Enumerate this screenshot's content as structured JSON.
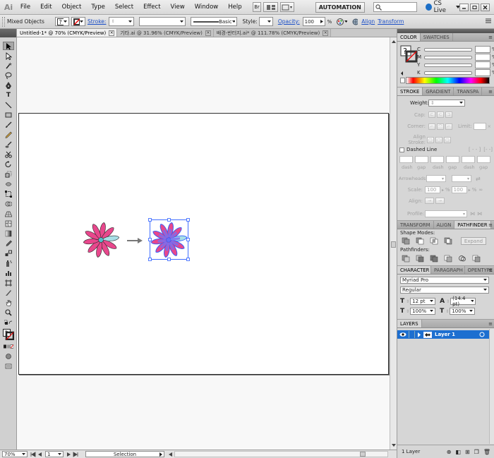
{
  "app_logo": "Ai",
  "menu": [
    "File",
    "Edit",
    "Object",
    "Type",
    "Select",
    "Effect",
    "View",
    "Window",
    "Help"
  ],
  "menubar": {
    "br_label": "Br",
    "workspace": "AUTOMATION",
    "cslive": "CS Live"
  },
  "control_bar": {
    "selection_label": "Mixed Objects",
    "stroke_label": "Stroke:",
    "brush_label": "Basic",
    "style_label": "Style:",
    "opacity_label": "Opacity:",
    "opacity_value": "100",
    "opacity_unit": "%",
    "align_link": "Align",
    "transform_link": "Transform"
  },
  "doc_tabs": [
    {
      "label": "Untitled-1* @ 70% (CMYK/Preview)",
      "active": true
    },
    {
      "label": "기타.ai @ 31.96% (CMYK/Preview)",
      "active": false
    },
    {
      "label": "배경-반터지.ai* @ 111.78% (CMYK/Preview)",
      "active": false
    }
  ],
  "status_bar": {
    "zoom": "70%",
    "artboard": "1",
    "tool": "Selection"
  },
  "color_panel": {
    "tabs": [
      "COLOR",
      "SWATCHES"
    ],
    "sliders": [
      {
        "label": "C",
        "unit": "%"
      },
      {
        "label": "M",
        "unit": "%"
      },
      {
        "label": "Y",
        "unit": "%"
      },
      {
        "label": "K",
        "unit": "%"
      }
    ]
  },
  "stroke_panel": {
    "tabs": [
      "STROKE",
      "GRADIENT",
      "TRANSPA"
    ],
    "weight_label": "Weight:",
    "cap_label": "Cap:",
    "corner_label": "Corner:",
    "limit_label": "Limit:",
    "align_label": "Align Stroke:",
    "dashed_label": "Dashed Line",
    "dash_labels": [
      "dash",
      "gap",
      "dash",
      "gap",
      "dash",
      "gap"
    ],
    "arrowheads_label": "Arrowheads:",
    "scale_label": "Scale:",
    "scale_1": "100",
    "scale_2": "100",
    "scale_unit": "%",
    "align2_label": "Align:",
    "profile_label": "Profile:"
  },
  "pathfinder_panel": {
    "tabs": [
      "TRANSFORM",
      "ALIGN",
      "PATHFINDER"
    ],
    "shape_modes_label": "Shape Modes:",
    "expand_label": "Expand",
    "pathfinders_label": "Pathfinders:"
  },
  "character_panel": {
    "tabs": [
      "CHARACTER",
      "PARAGRAPH",
      "OPENTYPE"
    ],
    "font_family": "Myriad Pro",
    "font_style": "Regular",
    "font_size": "12 pt",
    "leading": "(14.4 pt)",
    "vscale": "100%",
    "hscale": "100%"
  },
  "layers_panel": {
    "tabs": [
      "LAYERS"
    ],
    "layer_name": "Layer 1",
    "footer_count": "1 Layer"
  },
  "colors": {
    "petal_pink": "#e8478c",
    "petal_light": "#a7dfe6",
    "center": "#55bdc9",
    "selection_blue": "#2d5fff",
    "overlay_purple": "#7a6fee"
  }
}
